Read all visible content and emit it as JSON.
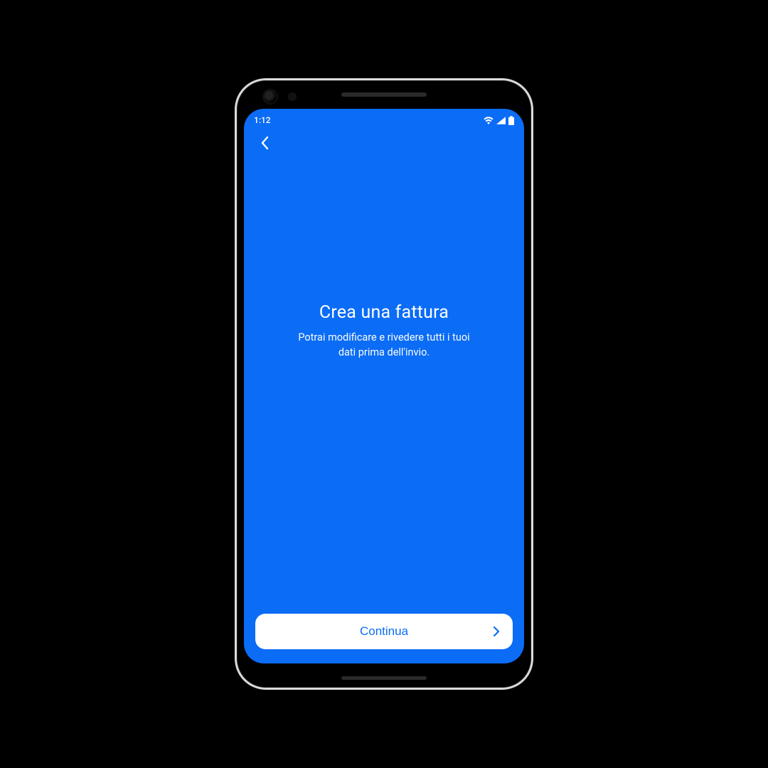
{
  "status": {
    "time": "1:12",
    "icons": {
      "wifi": "wifi-icon",
      "signal": "signal-icon",
      "battery": "battery-icon"
    }
  },
  "nav": {
    "back_label": "Back"
  },
  "screen": {
    "title": "Crea una fattura",
    "subtitle": "Potrai modificare e rivedere tutti i tuoi dati prima dell'invio."
  },
  "footer": {
    "continue_label": "Continua"
  },
  "colors": {
    "primary": "#0b6cf6",
    "on_primary": "#ffffff"
  }
}
